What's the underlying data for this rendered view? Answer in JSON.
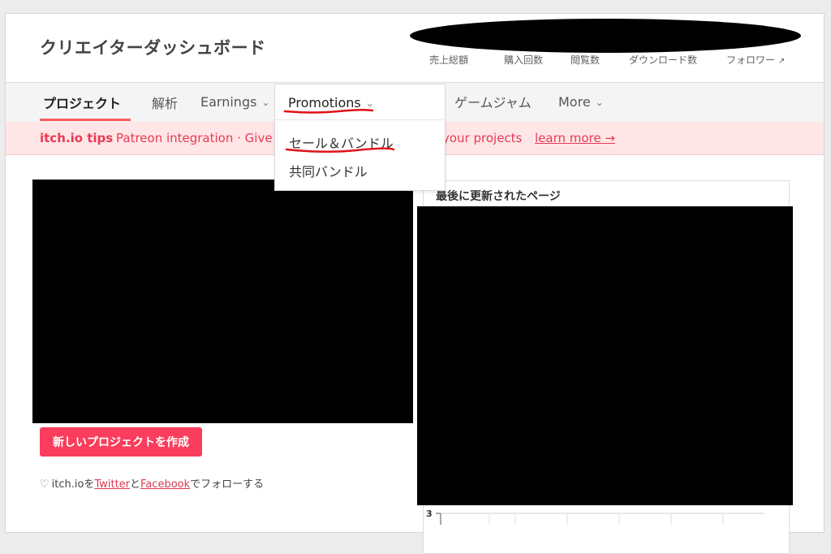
{
  "dashboard": {
    "title": "クリエイターダッシュボード"
  },
  "stats": [
    "売上総額",
    "購入回数",
    "閲覧数",
    "ダウンロード数",
    "フォロワー"
  ],
  "nav": {
    "tabs": [
      "プロジェクト",
      "解析",
      "Earnings",
      "ゲームジャム",
      "More"
    ],
    "dropdown_label": "Promotions"
  },
  "dropdown_menu": [
    "セール＆バンドル",
    "共同バンドル"
  ],
  "tips": {
    "brand": "itch.io tips",
    "message_start": "Patreon integration · Give y",
    "message_end": "your projects",
    "link": "learn more →"
  },
  "actions": {
    "create_project": "新しいプロジェクトを作成"
  },
  "social": {
    "prefix": "itch.ioを",
    "twitter": "Twitter",
    "and": "と",
    "facebook": "Facebook",
    "suffix": "でフォローする"
  },
  "recent": {
    "title": "最後に更新されたページ"
  },
  "chart_data": {
    "type": "bar",
    "y_tick": "3"
  },
  "colors": {
    "accent": "#fa5c5c",
    "button": "#fa3d5c",
    "tips_bg": "#ffe6e6"
  }
}
